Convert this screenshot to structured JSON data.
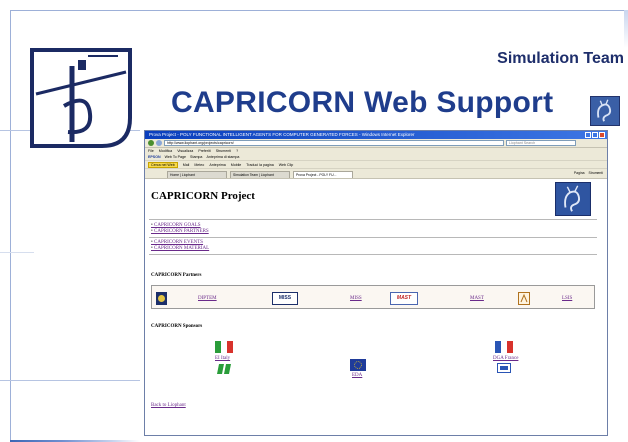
{
  "slide": {
    "team_label": "Simulation Team",
    "title": "CAPRICORN Web Support"
  },
  "browser": {
    "window_title": "Prova Project - POLY FUNCTIONAL INTELLIGENT AGENTS FOR COMPUTER GENERATED FORCES - Windows Internet Explorer",
    "address": "http://www.liophant.org/projects/capricorn/",
    "search_placeholder": "Liophant Search",
    "menu": [
      "File",
      "Modifica",
      "Visualizza",
      "Preferiti",
      "Strumenti",
      "?"
    ],
    "toolbar1": {
      "brand": "EPSON",
      "items": [
        "Web To Page",
        "Stampa",
        "Anteprima di stampa"
      ]
    },
    "toolbar2": {
      "search_pill": "Cerca nel Web",
      "items": [
        "Mail",
        "Meteo",
        "Anteprima",
        "Mobile",
        "Traduci la pagina",
        "Web Clip"
      ]
    },
    "tabs": [
      {
        "label": "Home | Liophant",
        "active": false
      },
      {
        "label": "Simulation Team | Liophant",
        "active": false
      },
      {
        "label": "Prova Project - POLY FU...",
        "active": true
      }
    ],
    "tab_tools": [
      "Pagina",
      "Strumenti"
    ]
  },
  "page": {
    "title": "CAPRICORN Project",
    "links_group1": [
      "CAPRICORN GOALS",
      "CAPRICORN PARTNERS"
    ],
    "links_group2": [
      "CAPRICORN EVENTS",
      "CAPRICORN MATERIAL"
    ],
    "partners_heading": "CAPRICORN Partners",
    "partners": [
      {
        "label": "DIPTEM",
        "logo": "diptem-logo"
      },
      {
        "label": "MISS",
        "logo": "miss-logo",
        "logo_text": "MISS"
      },
      {
        "label": "MAST",
        "logo": "mast-logo",
        "logo_text": "MAST"
      },
      {
        "label": "LSIS",
        "logo": "lsis-logo"
      }
    ],
    "sponsors_heading": "CAPRICORN Sponsors",
    "sponsors": [
      {
        "label": "EI Italy",
        "logo": "italy-flag"
      },
      {
        "label": "EDA",
        "logo": "eu-flag"
      },
      {
        "label": "DGA France",
        "logo": "france-flag"
      }
    ],
    "back_link": "Back to Liophant"
  },
  "colors": {
    "title_blue": "#1f3d8c",
    "link_purple": "#6a2a8a",
    "band_blue": "#3c67b5"
  }
}
